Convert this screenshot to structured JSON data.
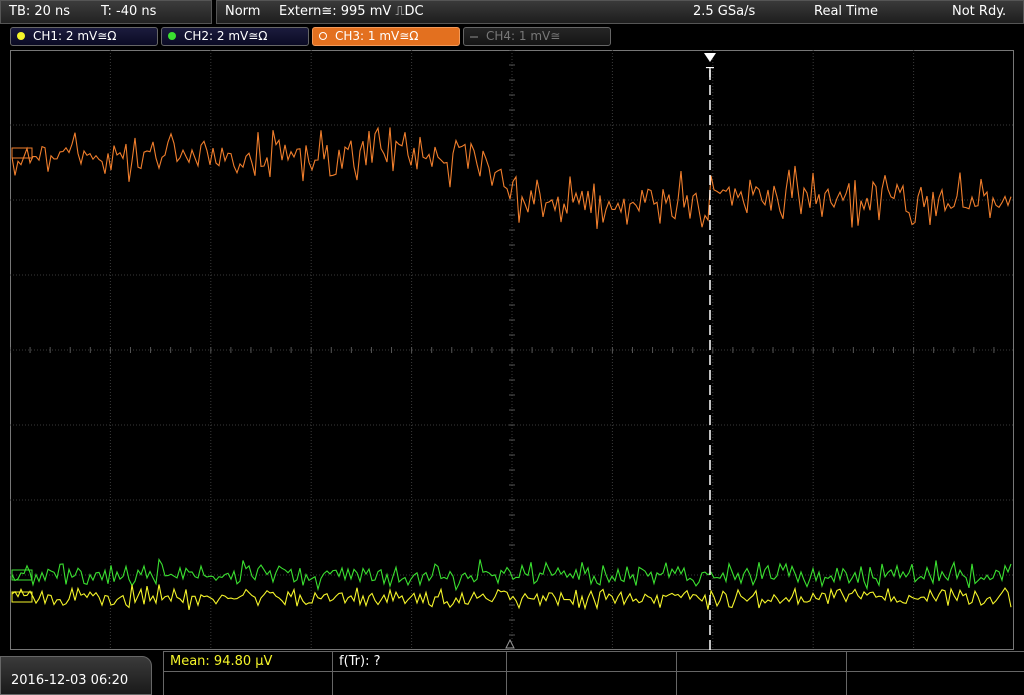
{
  "topbar": {
    "timebase": "TB: 20 ns",
    "trigger_time": "T: -40 ns",
    "mode": "Norm",
    "trigger_source": "Extern≅: 995 mV ⎍DC",
    "sample_rate": "2.5 GSa/s",
    "acq_mode": "Real Time",
    "status": "Not Rdy."
  },
  "channels": [
    {
      "label": "CH1: 2 mV≅Ω",
      "color": "#f5f52a",
      "state": "on"
    },
    {
      "label": "CH2: 2 mV≅Ω",
      "color": "#3ae030",
      "state": "on"
    },
    {
      "label": "CH3: 1 mV≅Ω",
      "color": "#e3701f",
      "state": "selected"
    },
    {
      "label": "CH4: 1 mV≅",
      "color": "#777777",
      "state": "off"
    }
  ],
  "trigger_marker": "T",
  "bottom": {
    "date": "2016-12-03 06:20",
    "mean_label": "Mean: 94.80 µV",
    "ftr_label": "f(Tr): ?"
  },
  "colors": {
    "ch1": "#f5f52a",
    "ch2": "#3ae030",
    "ch3": "#f07e2c",
    "mean_text": "#f5f52a"
  }
}
